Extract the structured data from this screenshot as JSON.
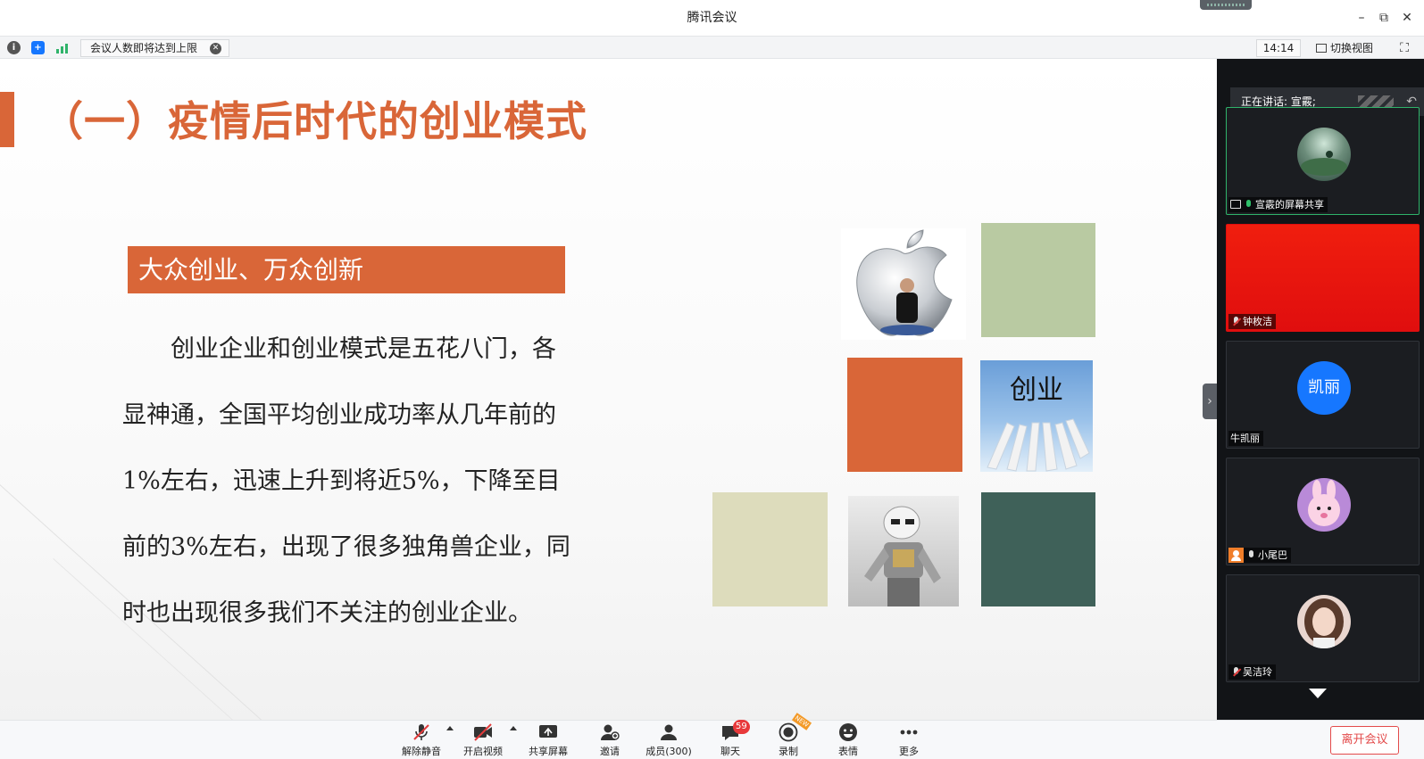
{
  "window": {
    "title": "腾讯会议",
    "controls": [
      "minimize-icon",
      "restore-icon",
      "close-icon"
    ]
  },
  "infobar": {
    "notice": "会议人数即将达到上限",
    "time": "14:14",
    "switch_view": "切换视图",
    "icons": [
      "info-icon",
      "security-shield-icon",
      "signal-icon",
      "fullscreen-icon"
    ]
  },
  "slide": {
    "title": "（一）疫情后时代的创业模式",
    "subtitle": "大众创业、万众创新",
    "body_lines": [
      "　　创业企业和创业模式是五花八门，各",
      "显神通，全国平均创业成功率从几年前的",
      "1%左右，迅速上升到将近5%，下降至目",
      "前的3%左右，出现了很多独角兽企业，同",
      "时也出现很多我们不关注的创业企业。"
    ],
    "image_word": "创业",
    "colors": {
      "accent": "#d96638",
      "green": "#b9caa2",
      "beige": "#dddcbc",
      "teal": "#3f6159"
    }
  },
  "panel": {
    "speaking": "正在讲话: 宣霰;",
    "participants": [
      {
        "label": "宣霰的屏幕共享",
        "status": "screen-share",
        "avatar": "landscape-avatar"
      },
      {
        "label": "钟枚洁",
        "status": "muted",
        "avatar": "red-video"
      },
      {
        "label": "牛凯丽",
        "status": "none",
        "avatar_text": "凯丽"
      },
      {
        "label": "小尾巴",
        "status": "mic-on",
        "avatar": "bunny-avatar"
      },
      {
        "label": "吴洁玲",
        "status": "muted",
        "avatar": "photo-avatar"
      }
    ]
  },
  "toolbar": {
    "unmute": "解除静音",
    "start_video": "开启视频",
    "share_screen": "共享屏幕",
    "invite": "邀请",
    "members": "成员(300)",
    "chat": "聊天",
    "chat_badge": "59",
    "record": "录制",
    "record_tag": "NEW",
    "reactions": "表情",
    "more": "更多",
    "leave": "离开会议"
  }
}
